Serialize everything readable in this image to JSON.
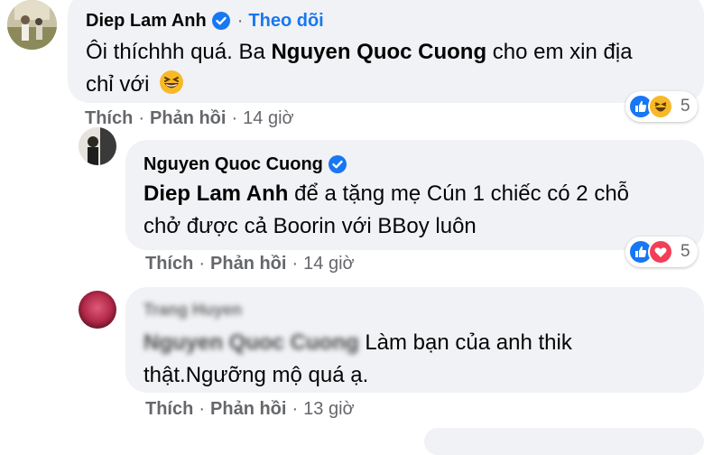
{
  "colors": {
    "accent": "#1877f2",
    "bubble_bg": "#f0f2f5",
    "meta_text": "#65676b",
    "like_blue": "#1877f2",
    "haha_yellow": "#f7b928",
    "love_red": "#f33e58"
  },
  "comments": [
    {
      "author": "Diep Lam Anh",
      "verified": true,
      "follow_separator": "·",
      "follow_label": "Theo dõi",
      "text_line1_prefix": "Ôi thíchhh quá. Ba ",
      "mention": "Nguyen Quoc Cuong",
      "text_line1_suffix": " cho em xin địa",
      "text_line2": "chỉ với",
      "emoji": "😆",
      "emoji_icon": "grinning-squinting-face-icon",
      "like_label": "Thích",
      "separator": "·",
      "reply_label": "Phản hồi",
      "time": "14 giờ",
      "reaction_icons": [
        "like-icon",
        "haha-icon"
      ],
      "reaction_count": "5"
    },
    {
      "author": "Nguyen Quoc Cuong",
      "verified": true,
      "mention": "Diep Lam Anh",
      "text_line1_suffix": " để a tặng mẹ Cún 1 chiếc có 2 chỗ",
      "text_line2": "chở được cả Boorin với BBoy luôn",
      "like_label": "Thích",
      "separator": "·",
      "reply_label": "Phản hồi",
      "time": "14 giờ",
      "reaction_icons": [
        "like-icon",
        "love-icon"
      ],
      "reaction_count": "5"
    },
    {
      "author_blurred": "Trang Huyen",
      "mention_blurred": "Nguyen Quoc Cuong",
      "text_line1_suffix": " Làm bạn của anh thik",
      "text_line2": "thật.Ngưỡng mộ quá ạ.",
      "like_label": "Thích",
      "separator": "·",
      "reply_label": "Phản hồi",
      "time": "13 giờ"
    }
  ]
}
